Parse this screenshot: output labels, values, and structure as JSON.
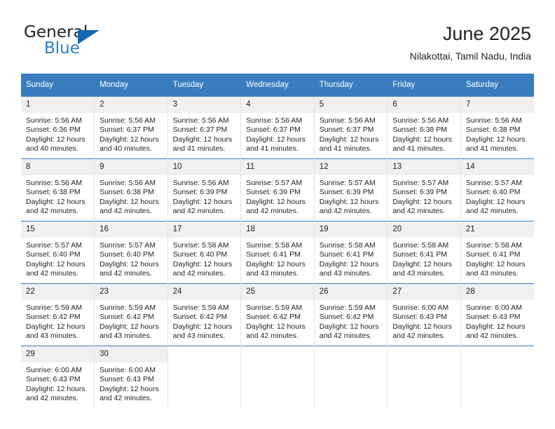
{
  "brand": {
    "name_top": "General",
    "name_bottom": "Blue",
    "accent_color": "#1268b3",
    "blue_text_color": "#2a7fc9"
  },
  "header": {
    "title": "June 2025",
    "subtitle": "Nilakottai, Tamil Nadu, India"
  },
  "theme": {
    "header_row_bg": "#3a7dbf",
    "daynum_bg": "#f0f0f0",
    "text_color": "#231f20"
  },
  "weekday_headers": [
    "Sunday",
    "Monday",
    "Tuesday",
    "Wednesday",
    "Thursday",
    "Friday",
    "Saturday"
  ],
  "labels": {
    "sunrise_prefix": "Sunrise:",
    "sunset_prefix": "Sunset:",
    "daylight_prefix": "Daylight:"
  },
  "weeks": [
    [
      {
        "day": "1",
        "sunrise": "Sunrise: 5:56 AM",
        "sunset": "Sunset: 6:36 PM",
        "daylight_line1": "Daylight: 12 hours",
        "daylight_line2": "and 40 minutes."
      },
      {
        "day": "2",
        "sunrise": "Sunrise: 5:56 AM",
        "sunset": "Sunset: 6:37 PM",
        "daylight_line1": "Daylight: 12 hours",
        "daylight_line2": "and 40 minutes."
      },
      {
        "day": "3",
        "sunrise": "Sunrise: 5:56 AM",
        "sunset": "Sunset: 6:37 PM",
        "daylight_line1": "Daylight: 12 hours",
        "daylight_line2": "and 41 minutes."
      },
      {
        "day": "4",
        "sunrise": "Sunrise: 5:56 AM",
        "sunset": "Sunset: 6:37 PM",
        "daylight_line1": "Daylight: 12 hours",
        "daylight_line2": "and 41 minutes."
      },
      {
        "day": "5",
        "sunrise": "Sunrise: 5:56 AM",
        "sunset": "Sunset: 6:37 PM",
        "daylight_line1": "Daylight: 12 hours",
        "daylight_line2": "and 41 minutes."
      },
      {
        "day": "6",
        "sunrise": "Sunrise: 5:56 AM",
        "sunset": "Sunset: 6:38 PM",
        "daylight_line1": "Daylight: 12 hours",
        "daylight_line2": "and 41 minutes."
      },
      {
        "day": "7",
        "sunrise": "Sunrise: 5:56 AM",
        "sunset": "Sunset: 6:38 PM",
        "daylight_line1": "Daylight: 12 hours",
        "daylight_line2": "and 41 minutes."
      }
    ],
    [
      {
        "day": "8",
        "sunrise": "Sunrise: 5:56 AM",
        "sunset": "Sunset: 6:38 PM",
        "daylight_line1": "Daylight: 12 hours",
        "daylight_line2": "and 42 minutes."
      },
      {
        "day": "9",
        "sunrise": "Sunrise: 5:56 AM",
        "sunset": "Sunset: 6:38 PM",
        "daylight_line1": "Daylight: 12 hours",
        "daylight_line2": "and 42 minutes."
      },
      {
        "day": "10",
        "sunrise": "Sunrise: 5:56 AM",
        "sunset": "Sunset: 6:39 PM",
        "daylight_line1": "Daylight: 12 hours",
        "daylight_line2": "and 42 minutes."
      },
      {
        "day": "11",
        "sunrise": "Sunrise: 5:57 AM",
        "sunset": "Sunset: 6:39 PM",
        "daylight_line1": "Daylight: 12 hours",
        "daylight_line2": "and 42 minutes."
      },
      {
        "day": "12",
        "sunrise": "Sunrise: 5:57 AM",
        "sunset": "Sunset: 6:39 PM",
        "daylight_line1": "Daylight: 12 hours",
        "daylight_line2": "and 42 minutes."
      },
      {
        "day": "13",
        "sunrise": "Sunrise: 5:57 AM",
        "sunset": "Sunset: 6:39 PM",
        "daylight_line1": "Daylight: 12 hours",
        "daylight_line2": "and 42 minutes."
      },
      {
        "day": "14",
        "sunrise": "Sunrise: 5:57 AM",
        "sunset": "Sunset: 6:40 PM",
        "daylight_line1": "Daylight: 12 hours",
        "daylight_line2": "and 42 minutes."
      }
    ],
    [
      {
        "day": "15",
        "sunrise": "Sunrise: 5:57 AM",
        "sunset": "Sunset: 6:40 PM",
        "daylight_line1": "Daylight: 12 hours",
        "daylight_line2": "and 42 minutes."
      },
      {
        "day": "16",
        "sunrise": "Sunrise: 5:57 AM",
        "sunset": "Sunset: 6:40 PM",
        "daylight_line1": "Daylight: 12 hours",
        "daylight_line2": "and 42 minutes."
      },
      {
        "day": "17",
        "sunrise": "Sunrise: 5:58 AM",
        "sunset": "Sunset: 6:40 PM",
        "daylight_line1": "Daylight: 12 hours",
        "daylight_line2": "and 42 minutes."
      },
      {
        "day": "18",
        "sunrise": "Sunrise: 5:58 AM",
        "sunset": "Sunset: 6:41 PM",
        "daylight_line1": "Daylight: 12 hours",
        "daylight_line2": "and 43 minutes."
      },
      {
        "day": "19",
        "sunrise": "Sunrise: 5:58 AM",
        "sunset": "Sunset: 6:41 PM",
        "daylight_line1": "Daylight: 12 hours",
        "daylight_line2": "and 43 minutes."
      },
      {
        "day": "20",
        "sunrise": "Sunrise: 5:58 AM",
        "sunset": "Sunset: 6:41 PM",
        "daylight_line1": "Daylight: 12 hours",
        "daylight_line2": "and 43 minutes."
      },
      {
        "day": "21",
        "sunrise": "Sunrise: 5:58 AM",
        "sunset": "Sunset: 6:41 PM",
        "daylight_line1": "Daylight: 12 hours",
        "daylight_line2": "and 43 minutes."
      }
    ],
    [
      {
        "day": "22",
        "sunrise": "Sunrise: 5:59 AM",
        "sunset": "Sunset: 6:42 PM",
        "daylight_line1": "Daylight: 12 hours",
        "daylight_line2": "and 43 minutes."
      },
      {
        "day": "23",
        "sunrise": "Sunrise: 5:59 AM",
        "sunset": "Sunset: 6:42 PM",
        "daylight_line1": "Daylight: 12 hours",
        "daylight_line2": "and 43 minutes."
      },
      {
        "day": "24",
        "sunrise": "Sunrise: 5:59 AM",
        "sunset": "Sunset: 6:42 PM",
        "daylight_line1": "Daylight: 12 hours",
        "daylight_line2": "and 43 minutes."
      },
      {
        "day": "25",
        "sunrise": "Sunrise: 5:59 AM",
        "sunset": "Sunset: 6:42 PM",
        "daylight_line1": "Daylight: 12 hours",
        "daylight_line2": "and 42 minutes."
      },
      {
        "day": "26",
        "sunrise": "Sunrise: 5:59 AM",
        "sunset": "Sunset: 6:42 PM",
        "daylight_line1": "Daylight: 12 hours",
        "daylight_line2": "and 42 minutes."
      },
      {
        "day": "27",
        "sunrise": "Sunrise: 6:00 AM",
        "sunset": "Sunset: 6:43 PM",
        "daylight_line1": "Daylight: 12 hours",
        "daylight_line2": "and 42 minutes."
      },
      {
        "day": "28",
        "sunrise": "Sunrise: 6:00 AM",
        "sunset": "Sunset: 6:43 PM",
        "daylight_line1": "Daylight: 12 hours",
        "daylight_line2": "and 42 minutes."
      }
    ],
    [
      {
        "day": "29",
        "sunrise": "Sunrise: 6:00 AM",
        "sunset": "Sunset: 6:43 PM",
        "daylight_line1": "Daylight: 12 hours",
        "daylight_line2": "and 42 minutes."
      },
      {
        "day": "30",
        "sunrise": "Sunrise: 6:00 AM",
        "sunset": "Sunset: 6:43 PM",
        "daylight_line1": "Daylight: 12 hours",
        "daylight_line2": "and 42 minutes."
      },
      {
        "day": "",
        "sunrise": "",
        "sunset": "",
        "daylight_line1": "",
        "daylight_line2": ""
      },
      {
        "day": "",
        "sunrise": "",
        "sunset": "",
        "daylight_line1": "",
        "daylight_line2": ""
      },
      {
        "day": "",
        "sunrise": "",
        "sunset": "",
        "daylight_line1": "",
        "daylight_line2": ""
      },
      {
        "day": "",
        "sunrise": "",
        "sunset": "",
        "daylight_line1": "",
        "daylight_line2": ""
      },
      {
        "day": "",
        "sunrise": "",
        "sunset": "",
        "daylight_line1": "",
        "daylight_line2": ""
      }
    ]
  ]
}
